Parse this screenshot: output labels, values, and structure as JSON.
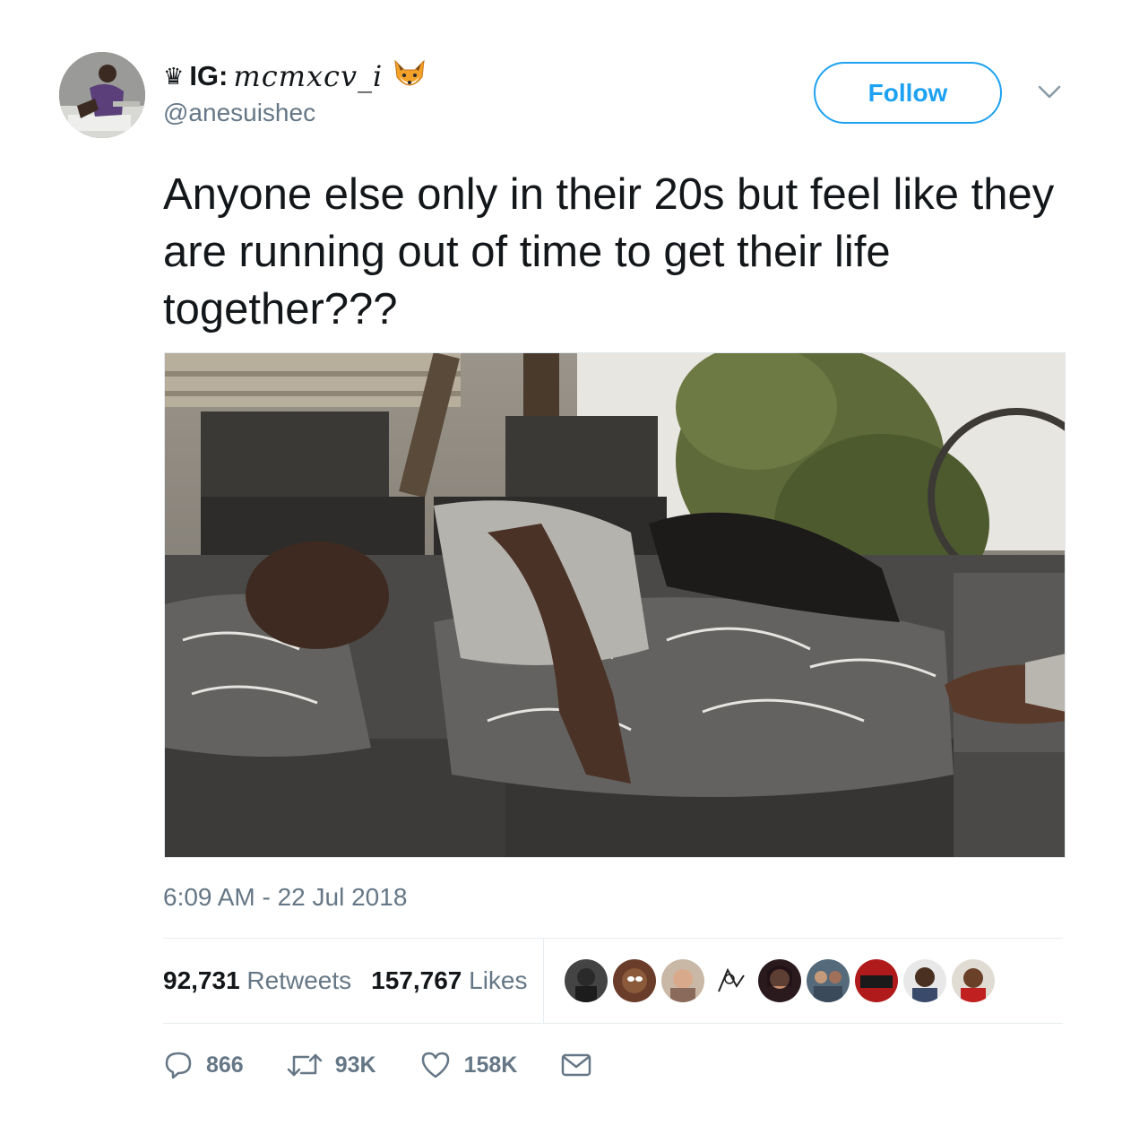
{
  "user": {
    "display_name_prefix": "IG:",
    "display_name_script": "mcmxcv_i",
    "username": "@anesuishec"
  },
  "follow": {
    "label": "Follow"
  },
  "tweet": {
    "text": "Anyone else only in their 20s but feel like they are running out of time to get their life together???",
    "timestamp": "6:09 AM - 22 Jul 2018"
  },
  "stats": {
    "retweets_count": "92,731",
    "retweets_label": "Retweets",
    "likes_count": "157,767",
    "likes_label": "Likes"
  },
  "actions": {
    "replies": "866",
    "retweets": "93K",
    "likes": "158K"
  },
  "colors": {
    "accent": "#1da1f2",
    "text": "#14171a",
    "muted": "#657786",
    "divider": "#e6ecf0"
  }
}
